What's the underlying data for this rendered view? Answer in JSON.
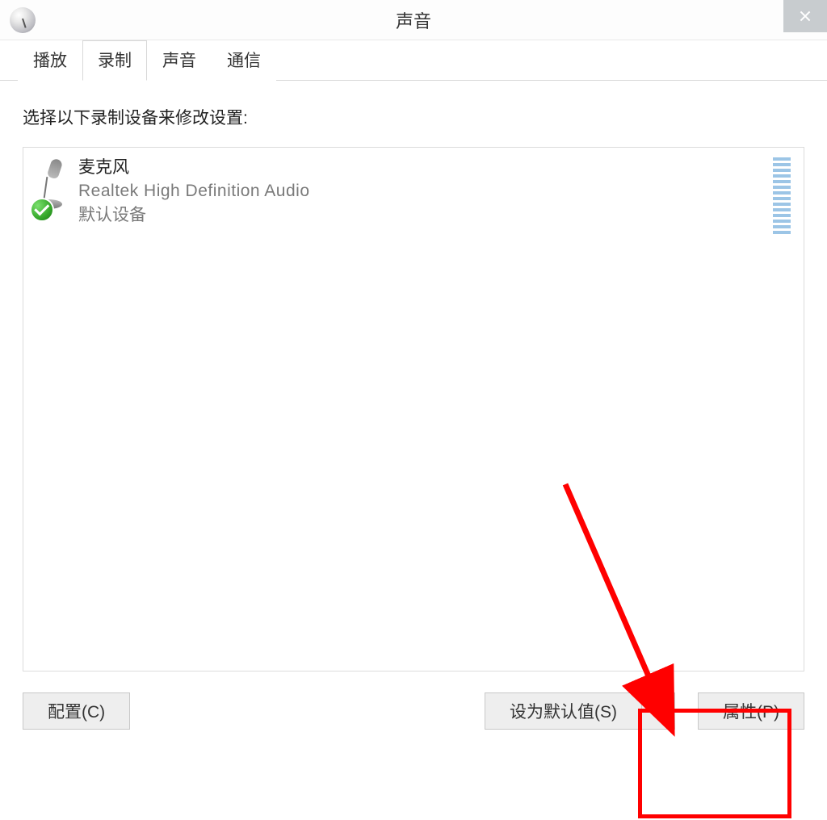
{
  "window": {
    "title": "声音"
  },
  "tabs": [
    {
      "label": "播放",
      "active": false
    },
    {
      "label": "录制",
      "active": true
    },
    {
      "label": "声音",
      "active": false
    },
    {
      "label": "通信",
      "active": false
    }
  ],
  "panel": {
    "instruction": "选择以下录制设备来修改设置:"
  },
  "device": {
    "name": "麦克风",
    "driver": "Realtek High Definition Audio",
    "status": "默认设备"
  },
  "buttons": {
    "configure": "配置(C)",
    "set_default": "设为默认值(S)",
    "properties": "属性(P)"
  },
  "annotation": {
    "highlight_target": "properties-button",
    "accent_color": "#ff0000"
  }
}
